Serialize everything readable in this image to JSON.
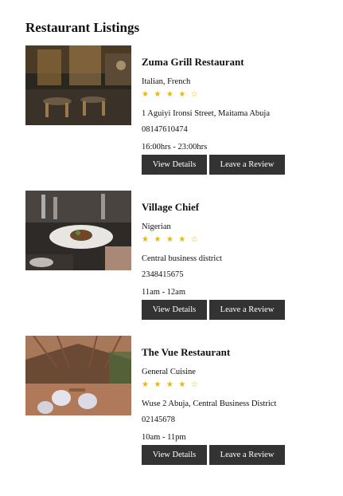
{
  "page": {
    "title": "Restaurant Listings"
  },
  "buttons": {
    "details": "View Details",
    "review": "Leave a Review"
  },
  "listings": [
    {
      "name": "Zuma Grill Restaurant",
      "cuisine": "Italian, French",
      "stars": "★ ★ ★ ★ ☆",
      "rating": 4,
      "address": "1 Aguiyi Ironsi Street, Maitama Abuja",
      "phone": "08147610474",
      "hours": "16:00hrs - 23:00hrs"
    },
    {
      "name": "Village Chief",
      "cuisine": "Nigerian",
      "stars": "★ ★ ★ ★ ☆",
      "rating": 4,
      "address": "Central business district",
      "phone": "2348415675",
      "hours": "11am - 12am"
    },
    {
      "name": "The Vue Restaurant",
      "cuisine": "General Cuisine",
      "stars": "★ ★ ★ ★ ☆",
      "rating": 4,
      "address": "Wuse 2 Abuja, Central Business District",
      "phone": "02145678",
      "hours": "10am - 11pm"
    }
  ],
  "colors": {
    "button_bg": "#333333",
    "star": "#f0b400"
  }
}
